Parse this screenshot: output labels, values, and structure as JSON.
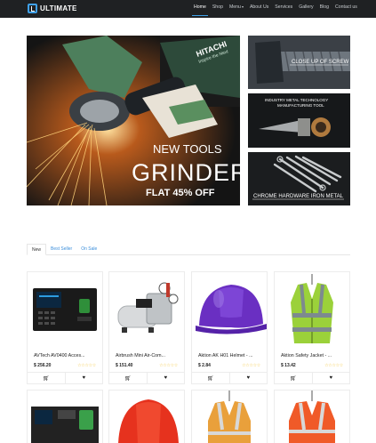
{
  "brand": {
    "name": "ULTIMATE",
    "accent": "#3fa0e8"
  },
  "nav": {
    "items": [
      {
        "label": "Home",
        "active": true
      },
      {
        "label": "Shop"
      },
      {
        "label": "Menu",
        "has_caret": true
      },
      {
        "label": "About Us"
      },
      {
        "label": "Services"
      },
      {
        "label": "Gallery"
      },
      {
        "label": "Blog"
      },
      {
        "label": "Contact us"
      }
    ]
  },
  "hero": {
    "brand_text": "HITACHI",
    "tagline": "Inspire the Next",
    "eyebrow": "NEW TOOLS",
    "headline": "GRINDER",
    "offer": "FLAT 45% OFF"
  },
  "side_banners": [
    {
      "label": "CLOSE UP OF SCREW"
    },
    {
      "label_line1": "INDUSTRY METAL TECHNOLOGY",
      "label_line2": "MANUFACTURING TOOL"
    },
    {
      "label": "CHROME HARDWARE IRON METAL"
    }
  ],
  "tabs": [
    {
      "label": "New",
      "active": true
    },
    {
      "label": "Best Seller"
    },
    {
      "label": "On Sale"
    }
  ],
  "products": [
    {
      "title": "AVTech AV0400 Acces...",
      "price": "$ 256.20",
      "stars": "☆☆☆☆☆",
      "image": "access-control-terminal"
    },
    {
      "title": "Airbrush Mini Air-Com...",
      "price": "$ 151.40",
      "stars": "☆☆☆☆☆",
      "image": "air-compressor"
    },
    {
      "title": "Aktion AK H01 Helmet - ...",
      "price": "$ 2.84",
      "stars": "☆☆☆☆☆",
      "image": "purple-helmet"
    },
    {
      "title": "Aktion Safety Jacket - ...",
      "price": "$ 13.42",
      "stars": "☆☆☆☆☆",
      "image": "safety-vest"
    }
  ],
  "product_row2": [
    {
      "image": "fingerprint-terminal"
    },
    {
      "image": "red-helmet"
    },
    {
      "image": "orange-vest"
    },
    {
      "image": "orange-vest-2"
    }
  ],
  "actions": {
    "cart_icon": "cart-icon",
    "wishlist_icon": "heart-icon"
  }
}
